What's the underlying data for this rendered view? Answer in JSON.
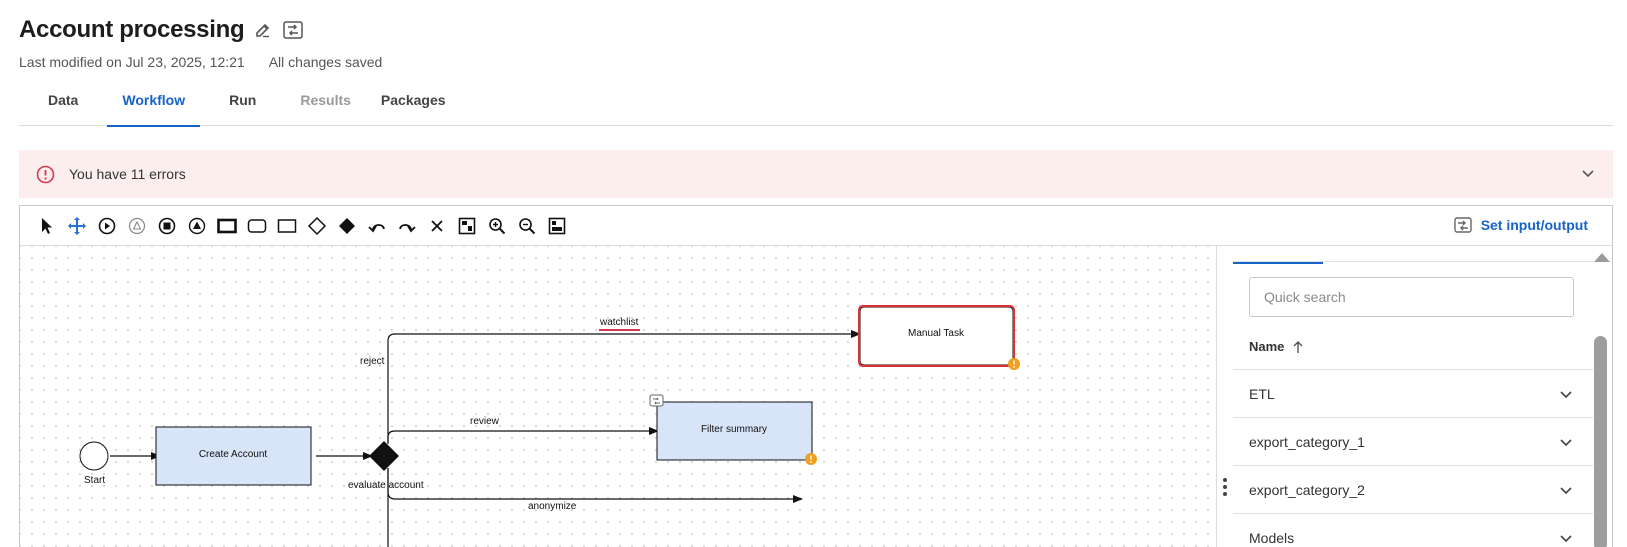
{
  "header": {
    "title": "Account processing",
    "last_modified": "Last modified on Jul 23, 2025, 12:21",
    "save_status": "All changes saved"
  },
  "tabs": [
    {
      "label": "Data",
      "state": "normal"
    },
    {
      "label": "Workflow",
      "state": "active"
    },
    {
      "label": "Run",
      "state": "normal"
    },
    {
      "label": "Results",
      "state": "disabled"
    },
    {
      "label": "Packages",
      "state": "normal"
    }
  ],
  "error_banner": {
    "text": "You have 11 errors"
  },
  "toolbar": {
    "tools": [
      "select-tool",
      "pan-tool",
      "start-event-tool",
      "intermediate-event-tool",
      "end-event-tool",
      "signal-event-tool",
      "task-tool",
      "subprocess-tool",
      "annotation-tool",
      "exclusive-gateway-tool",
      "parallel-gateway-tool",
      "undo-tool",
      "redo-tool",
      "delete-tool",
      "fit-to-screen-tool",
      "zoom-in-tool",
      "zoom-out-tool",
      "minimap-tool"
    ],
    "set_io_label": "Set input/output"
  },
  "diagram": {
    "start_label": "Start",
    "create_account_label": "Create Account",
    "gateway_label": "evaluate account",
    "manual_task_label": "Manual Task",
    "filter_summary_label": "Filter summary",
    "edge_reject": "reject",
    "edge_watchlist": "watchlist",
    "edge_review": "review",
    "edge_anonymize": "anonymize"
  },
  "side_panel": {
    "search_placeholder": "Quick search",
    "name_header": "Name",
    "items": [
      "ETL",
      "export_category_1",
      "export_category_2",
      "Models"
    ]
  },
  "colors": {
    "accent": "#1664c9",
    "error_bg": "#fdeeee",
    "error_icon": "#d9364f",
    "task_fill": "#d8e4f8",
    "warning": "#f0a020",
    "selected_border": "#e03030"
  }
}
